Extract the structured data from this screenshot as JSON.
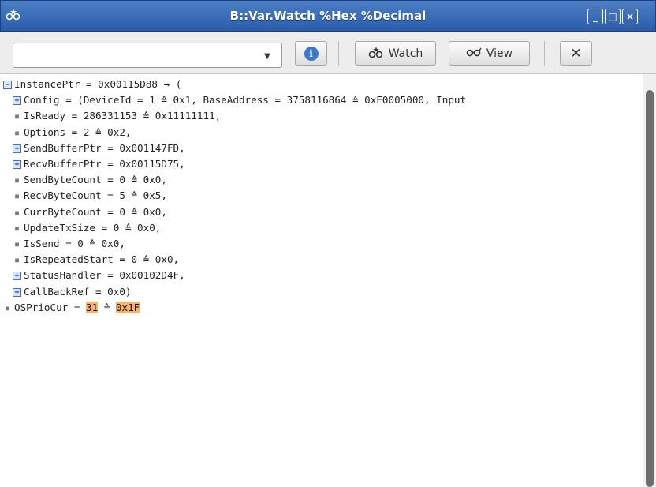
{
  "window": {
    "title": "B::Var.Watch %Hex %Decimal",
    "icon": "glasses-star-icon",
    "buttons": {
      "minimize": "_",
      "maximize": "□",
      "close": "×"
    }
  },
  "toolbar": {
    "combo_value": "",
    "combo_arrow": "▼",
    "info_glyph": "i",
    "watch_label": "Watch",
    "view_label": "View",
    "close_glyph": "✕"
  },
  "tree": [
    {
      "marker": "minus",
      "line": "InstancePtr = 0x00115D88 → ("
    },
    {
      "marker": "plus",
      "line": "Config = (DeviceId = 1 ≙ 0x1, BaseAddress = 3758116864 ≙ 0xE0005000, Input"
    },
    {
      "marker": "bullet",
      "line": "IsReady = 286331153 ≙ 0x11111111,"
    },
    {
      "marker": "bullet",
      "line": "Options = 2 ≙ 0x2,"
    },
    {
      "marker": "plus",
      "line": "SendBufferPtr = 0x001147FD,"
    },
    {
      "marker": "plus",
      "line": "RecvBufferPtr = 0x00115D75,"
    },
    {
      "marker": "bullet",
      "line": "SendByteCount = 0 ≙ 0x0,"
    },
    {
      "marker": "bullet",
      "line": "RecvByteCount = 5 ≙ 0x5,"
    },
    {
      "marker": "bullet",
      "line": "CurrByteCount = 0 ≙ 0x0,"
    },
    {
      "marker": "bullet",
      "line": "UpdateTxSize = 0 ≙ 0x0,"
    },
    {
      "marker": "bullet",
      "line": "IsSend = 0 ≙ 0x0,"
    },
    {
      "marker": "bullet",
      "line": "IsRepeatedStart = 0 ≙ 0x0,"
    },
    {
      "marker": "plus",
      "line": "StatusHandler = 0x00102D4F,"
    },
    {
      "marker": "plus",
      "line": "CallBackRef = 0x0)"
    }
  ],
  "last": {
    "prefix": "OSPrioCur = ",
    "dec": "31",
    "sep": " ≙ ",
    "hex": "0x1F"
  },
  "colors": {
    "title_bar": "#3b6db8",
    "highlight": "#fbb26a"
  }
}
